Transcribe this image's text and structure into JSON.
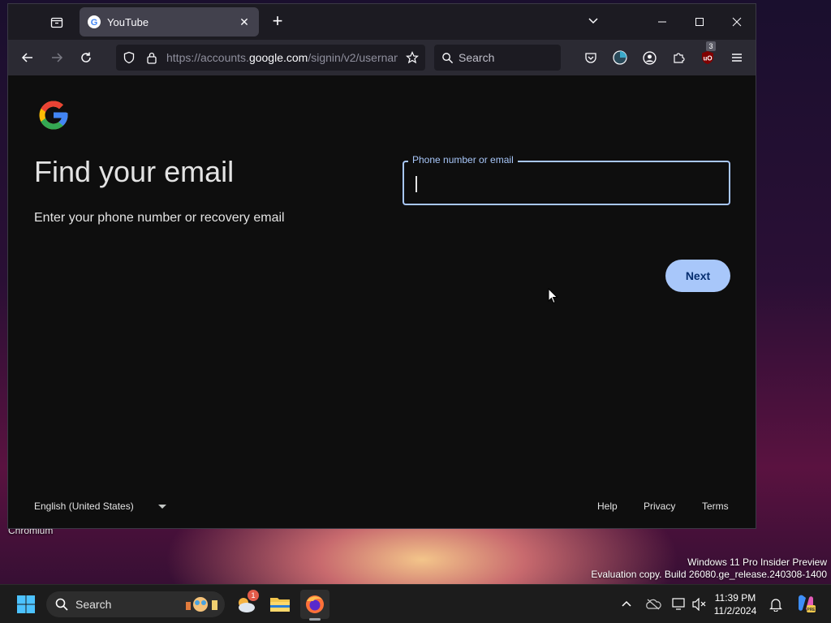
{
  "desktop": {
    "label_chromium": "Chromium",
    "watermark_line1": "Windows 11 Pro Insider Preview",
    "watermark_line2": "Evaluation copy. Build 26080.ge_release.240308-1400"
  },
  "browser": {
    "tab_title": "YouTube",
    "url_prefix": "https://accounts.",
    "url_host": "google.com",
    "url_path": "/signin/v2/usernam",
    "search_placeholder": "Search",
    "extension_badge": "3"
  },
  "page": {
    "heading": "Find your email",
    "subtext": "Enter your phone number or recovery email",
    "field_label": "Phone number or email",
    "field_value": "",
    "next_label": "Next",
    "language": "English (United States)",
    "footer_links": [
      "Help",
      "Privacy",
      "Terms"
    ]
  },
  "taskbar": {
    "search_label": "Search",
    "weather_badge": "1",
    "time": "11:39 PM",
    "date": "11/2/2024"
  },
  "colors": {
    "accent": "#a8c7fa",
    "page_bg": "#0e0e0e",
    "browser_chrome": "#2b2a33"
  }
}
